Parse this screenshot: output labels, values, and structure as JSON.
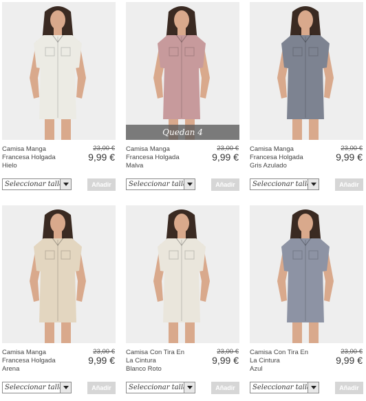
{
  "products": [
    {
      "name_lines": [
        "Camisa Manga",
        "Francesa Holgada",
        "Hielo"
      ],
      "price_old": "23,00 €",
      "price_new": "9,99 €",
      "size_select": "Seleccionar talla",
      "add_label": "Añadir",
      "shirt_color": "#ecebe4",
      "shorts_color": "#d7c8ae"
    },
    {
      "name_lines": [
        "Camisa Manga",
        "Francesa Holgada",
        "Malva"
      ],
      "price_old": "23,00 €",
      "price_new": "9,99 €",
      "size_select": "Seleccionar talla",
      "add_label": "Añadir",
      "banner": "Quedan 4",
      "shirt_color": "#c79a9c",
      "shorts_color": "#b88f8c"
    },
    {
      "name_lines": [
        "Camisa Manga",
        "Francesa Holgada",
        "Gris Azulado"
      ],
      "price_old": "23,00 €",
      "price_new": "9,99 €",
      "size_select": "Seleccionar talla",
      "add_label": "Añadir",
      "shirt_color": "#7d8391",
      "shorts_color": "#6f7582"
    },
    {
      "name_lines": [
        "Camisa Manga",
        "Francesa Holgada",
        "Arena"
      ],
      "price_old": "23,00 €",
      "price_new": "9,99 €",
      "size_select": "Seleccionar talla",
      "add_label": "Añadir",
      "shirt_color": "#e3d6c0",
      "shorts_color": "#d5c4a6"
    },
    {
      "name_lines": [
        "Camisa Con Tira En",
        "La Cintura",
        "Blanco Roto"
      ],
      "price_old": "23,00 €",
      "price_new": "9,99 €",
      "size_select": "Seleccionar talla",
      "add_label": "Añadir",
      "shirt_color": "#eae6dc",
      "shorts_color": "#c9b48f"
    },
    {
      "name_lines": [
        "Camisa Con Tira En",
        "La Cintura",
        "Azul"
      ],
      "price_old": "23,00 €",
      "price_new": "9,99 €",
      "size_select": "Seleccionar talla",
      "add_label": "Añadir",
      "shirt_color": "#8d93a4",
      "shorts_color": "#c7b491"
    }
  ]
}
